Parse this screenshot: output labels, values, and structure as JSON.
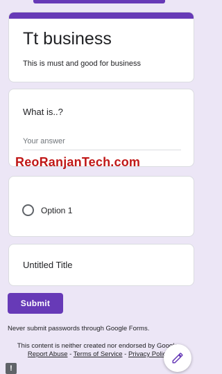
{
  "form": {
    "title": "Tt business",
    "description": "This is must and good for  business"
  },
  "questions": [
    {
      "title": "What is..?",
      "placeholder": "Your answer"
    },
    {
      "option_label": "Option 1"
    },
    {
      "title": "Untitled Title"
    }
  ],
  "watermark": "ReoRanjanTech.com",
  "submit_label": "Submit",
  "warning": "Never submit passwords through Google Forms.",
  "footer": {
    "text_before": "This content is neither created nor endorsed by Google.",
    "report_abuse": "Report Abuse",
    "separator1": " - ",
    "terms": "Terms of Service",
    "separator2": " - ",
    "privacy": "Privacy Policy"
  },
  "icons": {
    "fab": "pencil-icon",
    "report": "exclamation-icon"
  },
  "colors": {
    "accent": "#673ab7",
    "background": "#ece6f6",
    "watermark": "#c01818"
  }
}
